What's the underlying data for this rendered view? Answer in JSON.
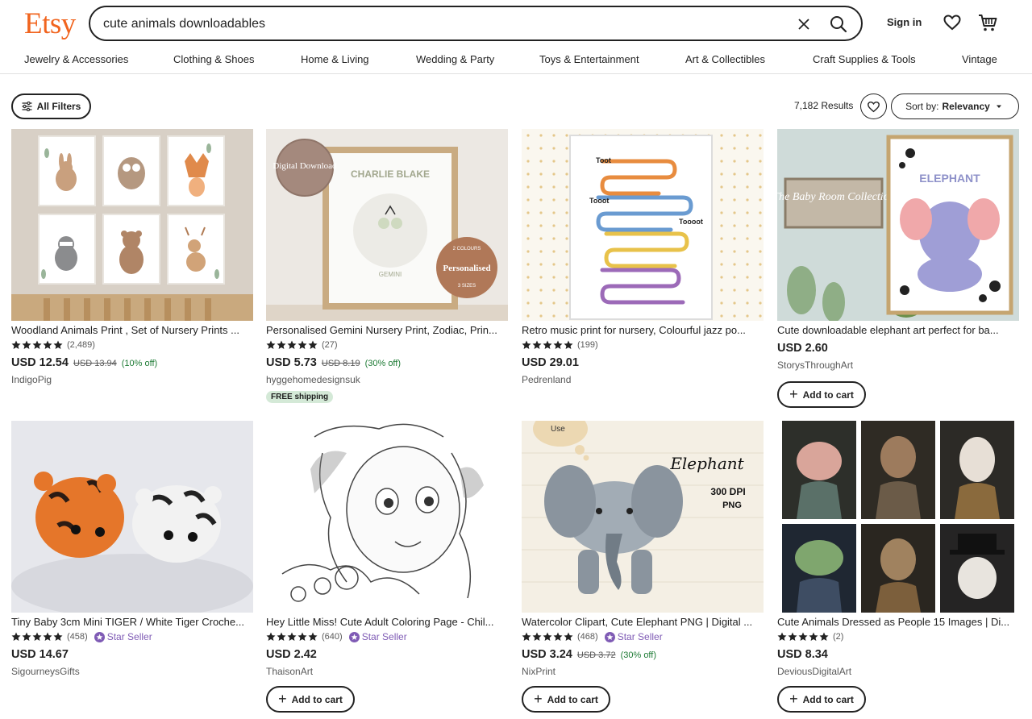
{
  "header": {
    "logo": "Etsy",
    "search_value": "cute animals downloadables",
    "signin": "Sign in"
  },
  "categories": [
    "Jewelry & Accessories",
    "Clothing & Shoes",
    "Home & Living",
    "Wedding & Party",
    "Toys & Entertainment",
    "Art & Collectibles",
    "Craft Supplies & Tools",
    "Vintage"
  ],
  "toolbar": {
    "filters_label": "All Filters",
    "results_count": "7,182 Results",
    "sort_prefix": "Sort by:",
    "sort_value": "Relevancy"
  },
  "colors": {
    "brand": "#F1641E",
    "star_seller": "#7F5BB5",
    "discount": "#1e7b35",
    "free_shipping_bg": "#d4e9d7"
  },
  "icons": {
    "clear": "close-icon",
    "search": "search-icon",
    "favorites": "heart-icon",
    "cart": "shopping-cart-icon",
    "filters": "sliders-icon",
    "sort": "caret-down-icon",
    "star": "star-icon"
  },
  "add_to_cart_label": "Add to cart",
  "star_seller_label": "Star Seller",
  "listings": [
    {
      "title": "Woodland Animals Print , Set of Nursery Prints ...",
      "reviews": "(2,489)",
      "price": "USD 12.54",
      "old_price": "USD 13.94",
      "discount": "(10% off)",
      "shop": "IndigoPig",
      "image": {
        "frame_lettering": []
      }
    },
    {
      "title": "Personalised Gemini Nursery Print, Zodiac, Prin...",
      "reviews": "(27)",
      "price": "USD 5.73",
      "old_price": "USD 8.19",
      "discount": "(30% off)",
      "shop": "hyggehomedesignsuk",
      "badge": "FREE shipping",
      "image": {
        "badge_left": "Digital Download",
        "name": "CHARLIE BLAKE",
        "sign": "GEMINI",
        "badge_right_top": "2 COLOURS",
        "badge_right": "Personalised",
        "badge_right_bottom": "3 SIZES"
      }
    },
    {
      "title": "Retro music print for nursery, Colourful jazz po...",
      "reviews": "(199)",
      "price": "USD 29.01",
      "shop": "Pedrenland",
      "image": {
        "word1": "Toot",
        "word2": "Toooot",
        "word3": "Tooot"
      }
    },
    {
      "title": "Cute downloadable elephant art perfect for ba...",
      "price": "USD 2.60",
      "shop": "StorysThroughArt",
      "add_to_cart": true,
      "image": {
        "sign": "The Baby Room Collection",
        "label": "ELEPHANT"
      }
    },
    {
      "title": "Tiny Baby 3cm Mini TIGER / White Tiger Croche...",
      "reviews": "(458)",
      "star_seller": true,
      "price": "USD 14.67",
      "shop": "SigourneysGifts"
    },
    {
      "title": "Hey Little Miss! Cute Adult Coloring Page - Chil...",
      "reviews": "(640)",
      "star_seller": true,
      "price": "USD 2.42",
      "shop": "ThaisonArt",
      "add_to_cart": true
    },
    {
      "title": "Watercolor Clipart, Cute Elephant PNG | Digital ...",
      "reviews": "(468)",
      "star_seller": true,
      "price": "USD 3.24",
      "old_price": "USD 3.72",
      "discount": "(30% off)",
      "shop": "NixPrint",
      "add_to_cart": true,
      "image": {
        "bubble": "Use",
        "script": "Elephant",
        "dpi": "300 DPI",
        "format": "PNG"
      }
    },
    {
      "title": "Cute Animals Dressed as People 15 Images | Di...",
      "reviews": "(2)",
      "price": "USD 8.34",
      "shop": "DeviousDigitalArt",
      "add_to_cart": true
    }
  ]
}
